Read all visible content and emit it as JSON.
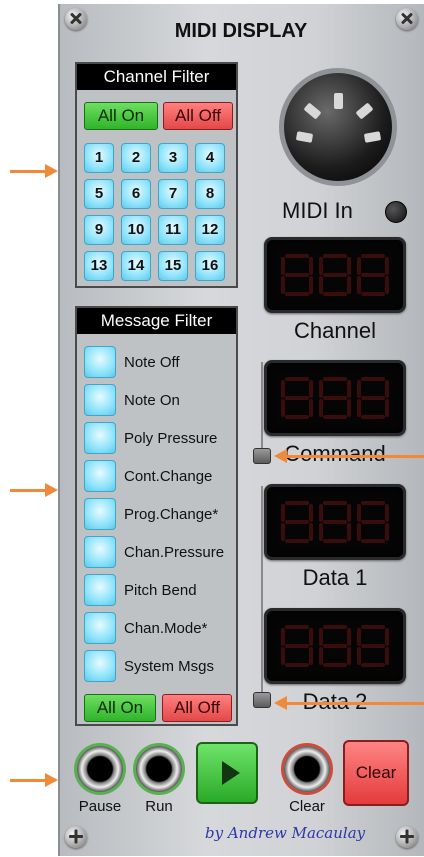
{
  "title": "MIDI DISPLAY",
  "channel_filter": {
    "heading": "Channel Filter",
    "all_on": "All On",
    "all_off": "All Off",
    "channels": [
      "1",
      "2",
      "3",
      "4",
      "5",
      "6",
      "7",
      "8",
      "9",
      "10",
      "11",
      "12",
      "13",
      "14",
      "15",
      "16"
    ]
  },
  "message_filter": {
    "heading": "Message Filter",
    "items": [
      "Note Off",
      "Note On",
      "Poly Pressure",
      "Cont.Change",
      "Prog.Change*",
      "Chan.Pressure",
      "Pitch Bend",
      "Chan.Mode*",
      "System Msgs"
    ],
    "all_on": "All On",
    "all_off": "All Off"
  },
  "midi_in_label": "MIDI In",
  "displays": {
    "channel": "Channel",
    "command": "Command",
    "data1": "Data 1",
    "data2": "Data 2"
  },
  "controls": {
    "pause": "Pause",
    "run": "Run",
    "clear_jack": "Clear",
    "clear_button": "Clear"
  },
  "credit": "by Andrew Macaulay",
  "colors": {
    "accent_arrow": "#f08a3a",
    "led_blue": "#8fe3fb",
    "on_green": "#2fb42a",
    "off_red": "#e34848"
  }
}
